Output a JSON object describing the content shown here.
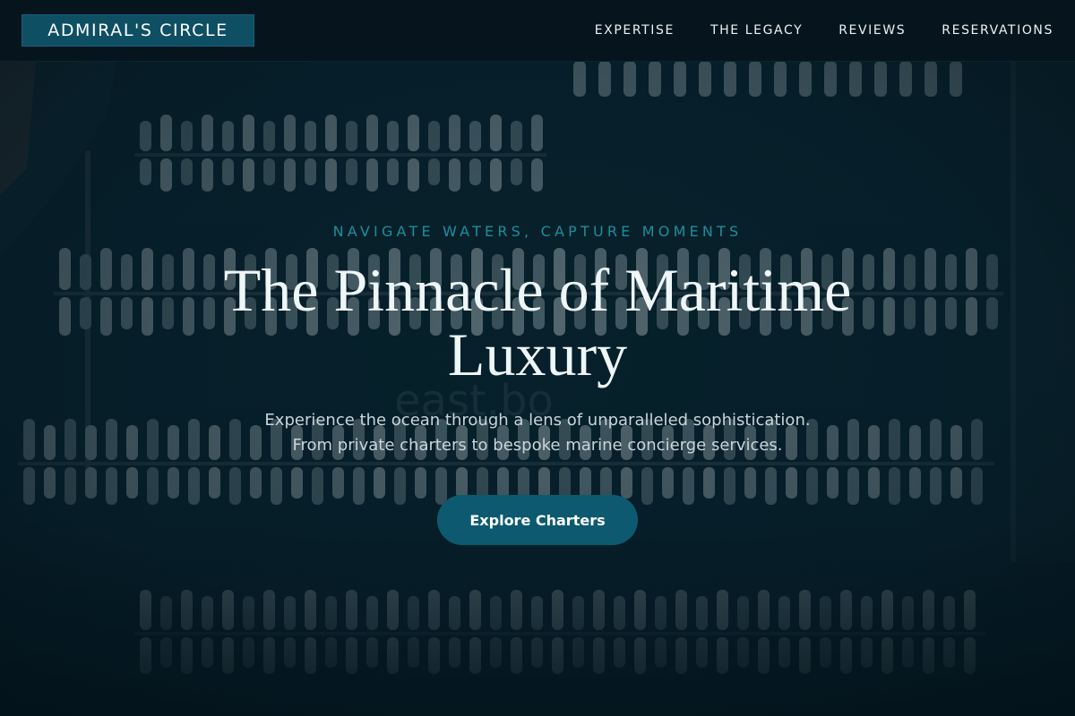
{
  "brand": {
    "logo_text": "ADMIRAL'S CIRCLE"
  },
  "nav": {
    "items": [
      {
        "label": "EXPERTISE"
      },
      {
        "label": "THE LEGACY"
      },
      {
        "label": "REVIEWS"
      },
      {
        "label": "RESERVATIONS"
      }
    ]
  },
  "hero": {
    "tagline": "NAVIGATE WATERS, CAPTURE MOMENTS",
    "headline": "The Pinnacle of Maritime Luxury",
    "subtitle_line1": "Experience the ocean through a lens of unparalleled sophistication.",
    "subtitle_line2": "From private charters to bespoke marine concierge services.",
    "cta_label": "Explore Charters",
    "watermark": "east.bo"
  },
  "colors": {
    "accent": "#0d5a70",
    "tagline": "#1f8d9c",
    "background": "#041822",
    "header": "#06141d"
  }
}
